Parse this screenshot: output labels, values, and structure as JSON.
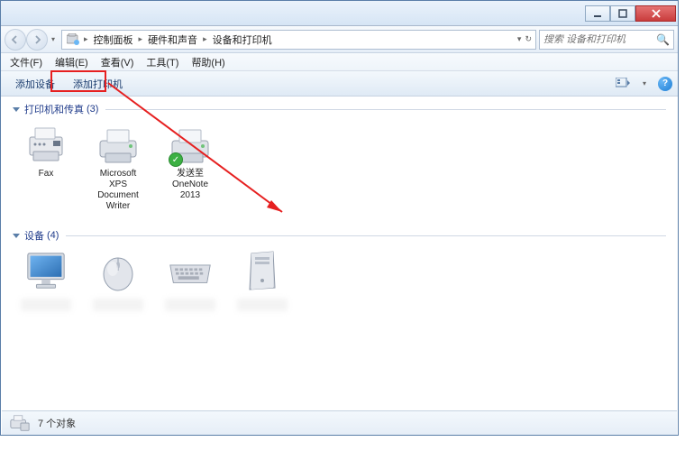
{
  "title": "设备和打印机",
  "window_controls": {
    "minimize": "−",
    "maximize": "□",
    "close": "×"
  },
  "breadcrumb": {
    "root": "控制面板",
    "mid": "硬件和声音",
    "leaf": "设备和打印机"
  },
  "search": {
    "placeholder": "搜索 设备和打印机"
  },
  "menubar": {
    "file": "文件(F)",
    "edit": "编辑(E)",
    "view": "查看(V)",
    "tools": "工具(T)",
    "help": "帮助(H)"
  },
  "toolbar": {
    "add_device": "添加设备",
    "add_printer": "添加打印机"
  },
  "groups": {
    "printers": {
      "label": "打印机和传真",
      "count": "(3)"
    },
    "devices": {
      "label": "设备",
      "count": "(4)"
    }
  },
  "printers": [
    {
      "name": "Fax"
    },
    {
      "name": "Microsoft XPS Document Writer"
    },
    {
      "name": "发送至 OneNote 2013",
      "default": true
    }
  ],
  "statusbar": {
    "text": "7 个对象"
  }
}
